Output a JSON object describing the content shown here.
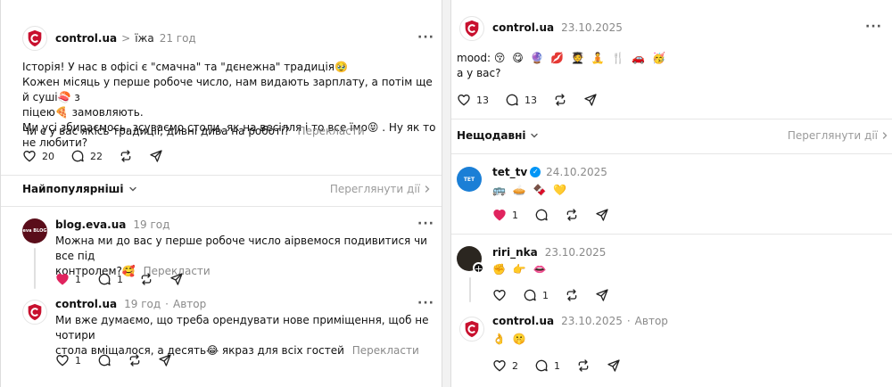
{
  "left": {
    "post": {
      "username": "control.ua",
      "separator": ">",
      "topic": "їжа",
      "time": "21 год",
      "lines": [
        "Історія! У нас в офісі є \"смачна\" та \"дєнежна\" традиція🥹",
        "Кожен місяць у перше робоче число, нам видають зарплату, а потім ще й суші🍣 з",
        "піцею🍕 замовляють.",
        "Ми усі збираємось, зсуваємо столи, як на весілля і то все їмо😝 . Ну як то не любити?"
      ],
      "question": "Чи є у вас якісь традиції, дивні дива на роботі?",
      "translate": "Перекласти",
      "likes": "20",
      "comments": "22"
    },
    "sort": {
      "label": "Найпопулярніші",
      "activity": "Переглянути дії"
    },
    "reply1": {
      "username": "blog.eva.ua",
      "avatar_text": "eva BLOG",
      "time": "19 год",
      "lines": [
        "Можна ми до вас у перше робоче число аірвемося подивитися чи все під",
        "контролем?🥰"
      ],
      "translate": "Перекласти",
      "likes": "1",
      "comments": "1"
    },
    "reply2": {
      "username": "control.ua",
      "time": "19 год",
      "author": "Автор",
      "lines": [
        "Ми вже думаємо, що треба орендувати нове приміщення, щоб не чотири",
        "стола вміщалося, а десять😂 якраз для всіх гостей"
      ],
      "translate": "Перекласти",
      "likes": "1"
    }
  },
  "right": {
    "post": {
      "username": "control.ua",
      "time": "23.10.2025",
      "mood_label": "mood:",
      "mood_emojis": "😚 😋 🔮 💋 🧑‍🎓 🧘 🍴 🚗 🥳",
      "line2": "а у вас?",
      "likes": "13",
      "comments": "13"
    },
    "sort": {
      "label": "Нещодавні",
      "activity": "Переглянути дії"
    },
    "reply1": {
      "username": "tet_tv",
      "verified": "✓",
      "avatar_text": "TET",
      "time": "24.10.2025",
      "emojis": "🚌 🥧 🍫 💛",
      "likes": "1"
    },
    "reply2": {
      "username": "riri_nka",
      "time": "23.10.2025",
      "emojis": "✊ 👉 👄",
      "comments": "1"
    },
    "reply3": {
      "username": "control.ua",
      "time": "23.10.2025",
      "author": "Автор",
      "emojis": "👌 🤫",
      "likes": "2",
      "comments": "1"
    }
  },
  "colors": {
    "accent_red": "#c8102e",
    "like_red": "#e0245e",
    "muted": "#8a8a8a",
    "verified_blue": "#0095f6"
  }
}
